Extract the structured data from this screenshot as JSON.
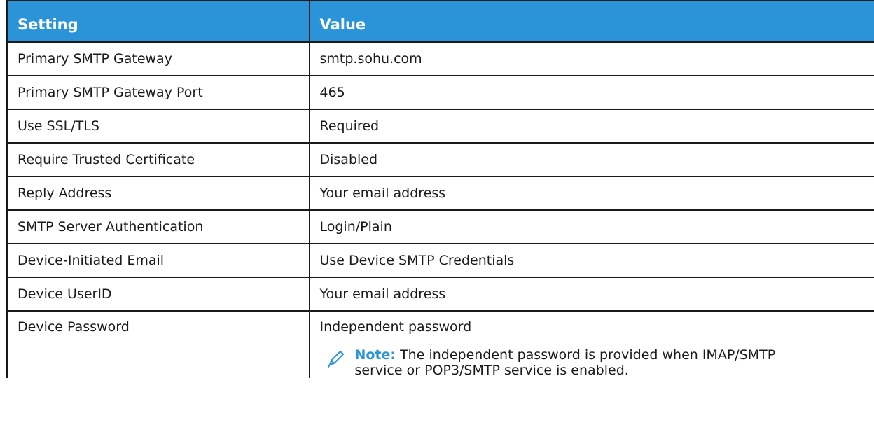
{
  "table": {
    "headers": {
      "setting": "Setting",
      "value": "Value"
    },
    "rows": [
      {
        "setting": "Primary SMTP Gateway",
        "value": "smtp.sohu.com"
      },
      {
        "setting": "Primary SMTP Gateway Port",
        "value": "465"
      },
      {
        "setting": "Use SSL/TLS",
        "value": "Required"
      },
      {
        "setting": "Require Trusted Certificate",
        "value": "Disabled"
      },
      {
        "setting": "Reply Address",
        "value": "Your email address"
      },
      {
        "setting": "SMTP Server Authentication",
        "value": "Login/Plain"
      },
      {
        "setting": "Device-Initiated Email",
        "value": "Use Device SMTP Credentials"
      },
      {
        "setting": "Device UserID",
        "value": "Your email address"
      },
      {
        "setting": "Device Password",
        "value": "Independent password"
      }
    ],
    "note": {
      "icon": "pencil-icon",
      "label": "Note:",
      "text_line1": " The independent password is provided when IMAP/SMTP",
      "text_line2": "service or POP3/SMTP service is enabled."
    }
  },
  "colors": {
    "header_bg": "#2b94d8",
    "header_text": "#ffffff",
    "note_label": "#2b94d8",
    "border": "#1a1a1a"
  }
}
